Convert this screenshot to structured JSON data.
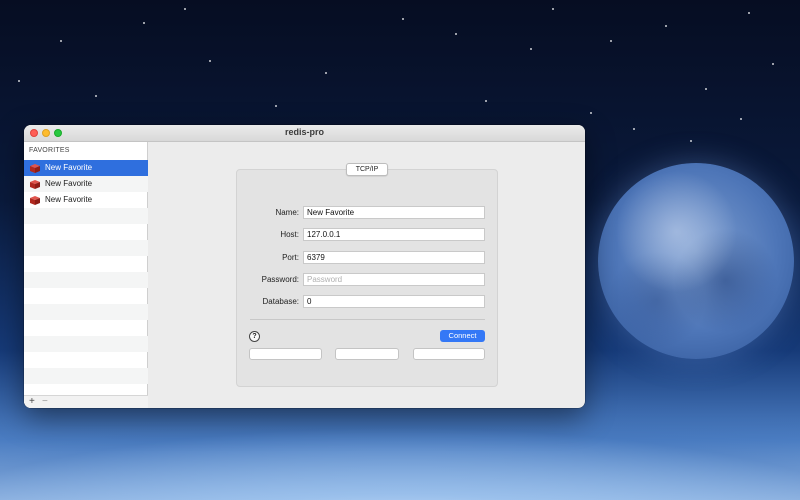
{
  "window": {
    "title": "redis-pro"
  },
  "sidebar": {
    "header": "FAVORITES",
    "items": [
      {
        "label": "New Favorite",
        "selected": true
      },
      {
        "label": "New Favorite",
        "selected": false
      },
      {
        "label": "New Favorite",
        "selected": false
      }
    ],
    "add_symbol": "+",
    "remove_symbol": "−",
    "item_icon": "redis-cube-icon"
  },
  "form": {
    "tab_label": "TCP/IP",
    "fields": {
      "name": {
        "label": "Name:",
        "value": "New Favorite"
      },
      "host": {
        "label": "Host:",
        "value": "127.0.0.1"
      },
      "port": {
        "label": "Port:",
        "value": "6379"
      },
      "password": {
        "label": "Password:",
        "value": "",
        "placeholder": "Password"
      },
      "database": {
        "label": "Database:",
        "value": "0"
      }
    },
    "help_symbol": "?",
    "connect_label": "Connect"
  },
  "colors": {
    "accent": "#3478f6",
    "selection": "#2f6fde",
    "redis_red": "#c7322a"
  }
}
